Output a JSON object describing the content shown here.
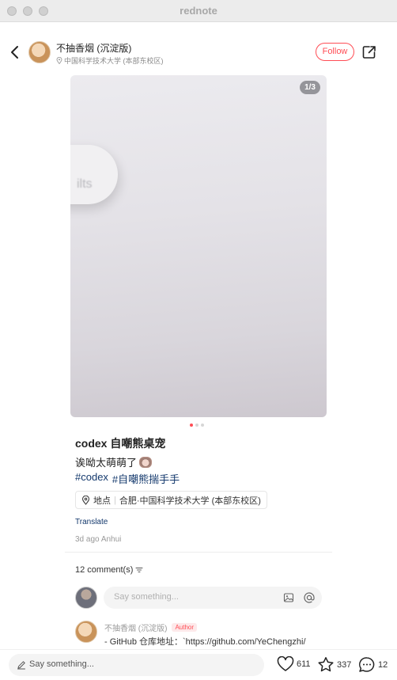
{
  "window": {
    "title": "rednote"
  },
  "header": {
    "author_name": "不抽香烟 (沉淀版)",
    "author_location": "中国科学技术大学 (本部东校区)",
    "follow_label": "Follow"
  },
  "media": {
    "counter": "1/3",
    "blur_text": "ilts",
    "page_count": 3,
    "active_page": 1
  },
  "post": {
    "title": "codex 自嘲熊桌宠",
    "description": "诶呦太萌萌了",
    "tags": [
      "#codex",
      "#自嘲熊揣手手"
    ],
    "location_label": "地点",
    "location_value": "合肥·中国科学技术大学 (本部东校区)",
    "translate_label": "Translate",
    "meta": "3d ago Anhui"
  },
  "comments": {
    "count_label": "12 comment(s)",
    "input_placeholder": "Say something...",
    "items": [
      {
        "author": "不抽香烟 (沉淀版)",
        "badge": "Author",
        "text": "- GitHub 仓库地址：`https://github.com/YeChengzhi/"
      }
    ]
  },
  "bottom_bar": {
    "input_placeholder": "Say something...",
    "likes": "611",
    "favorites": "337",
    "comments": "12"
  },
  "colors": {
    "accent": "#ff4d55",
    "link": "#13386c"
  }
}
